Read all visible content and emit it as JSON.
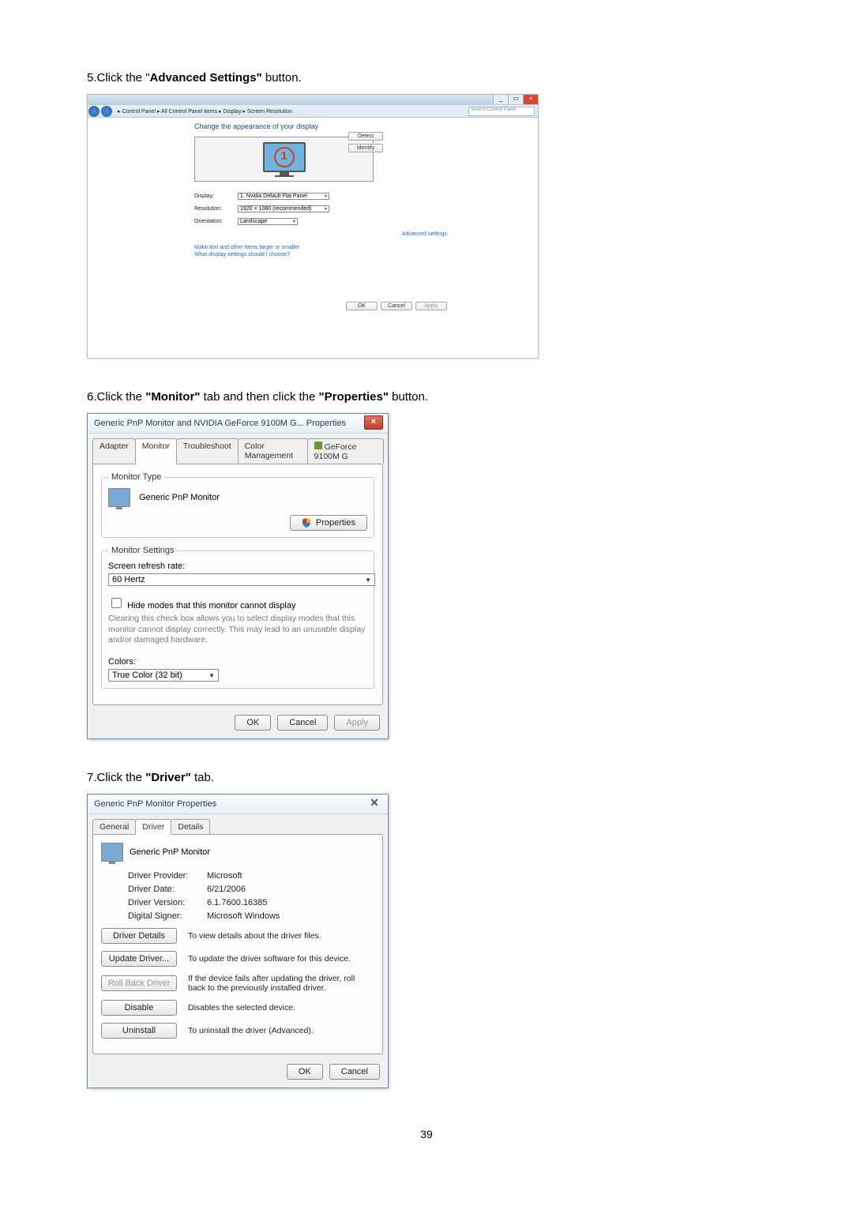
{
  "step5": {
    "text_prefix": "5.Click the \"",
    "text_bold": "Advanced Settings\"",
    "text_suffix": " button."
  },
  "shot1": {
    "breadcrumb": "▸ Control Panel ▸ All Control Panel Items ▸ Display ▸ Screen Resolution",
    "search_placeholder": "Search Control Panel",
    "heading": "Change the appearance of your display",
    "monitor_num": "1",
    "btn_detect": "Detect",
    "btn_identify": "Identify",
    "lbl_display": "Display:",
    "val_display": "1. Nvidia Default Flat Panel",
    "lbl_resolution": "Resolution:",
    "val_resolution": "1920 × 1080 (recommended)",
    "lbl_orientation": "Orientation:",
    "val_orientation": "Landscape",
    "adv_link": "Advanced settings",
    "link1": "Make text and other items larger or smaller",
    "link2": "What display settings should I choose?",
    "btn_ok": "OK",
    "btn_cancel": "Cancel",
    "btn_apply": "Apply"
  },
  "step6": {
    "text_prefix": "6.Click the ",
    "text_bold1": "\"Monitor\"",
    "text_mid": " tab and then click the ",
    "text_bold2": "\"Properties\"",
    "text_suffix": " button."
  },
  "dlg2": {
    "title": "Generic PnP Monitor and NVIDIA GeForce 9100M G... Properties",
    "tabs": {
      "adapter": "Adapter",
      "monitor": "Monitor",
      "troubleshoot": "Troubleshoot",
      "colormgmt": "Color Management",
      "gpu": "GeForce 9100M G"
    },
    "grp_monitor_type": "Monitor Type",
    "monitor_name": "Generic PnP Monitor",
    "btn_properties": "Properties",
    "grp_monitor_settings": "Monitor Settings",
    "lbl_refresh": "Screen refresh rate:",
    "val_refresh": "60 Hertz",
    "chk_hide": "Hide modes that this monitor cannot display",
    "helptext": "Clearing this check box allows you to select display modes that this monitor cannot display correctly. This may lead to an unusable display and/or damaged hardware.",
    "lbl_colors": "Colors:",
    "val_colors": "True Color (32 bit)",
    "btn_ok": "OK",
    "btn_cancel": "Cancel",
    "btn_apply": "Apply"
  },
  "step7": {
    "text_prefix": "7.Click the ",
    "text_bold": "\"Driver\"",
    "text_suffix": " tab."
  },
  "dlg3": {
    "title": "Generic PnP Monitor Properties",
    "tabs": {
      "general": "General",
      "driver": "Driver",
      "details": "Details"
    },
    "monitor_name": "Generic PnP Monitor",
    "lbl_provider": "Driver Provider:",
    "val_provider": "Microsoft",
    "lbl_date": "Driver Date:",
    "val_date": "6/21/2006",
    "lbl_version": "Driver Version:",
    "val_version": "6.1.7600.16385",
    "lbl_signer": "Digital Signer:",
    "val_signer": "Microsoft Windows",
    "btn_details": "Driver Details",
    "desc_details": "To view details about the driver files.",
    "btn_update": "Update Driver...",
    "desc_update": "To update the driver software for this device.",
    "btn_rollback": "Roll Back Driver",
    "desc_rollback": "If the device fails after updating the driver, roll back to the previously installed driver.",
    "btn_disable": "Disable",
    "desc_disable": "Disables the selected device.",
    "btn_uninstall": "Uninstall",
    "desc_uninstall": "To uninstall the driver (Advanced).",
    "btn_ok": "OK",
    "btn_cancel": "Cancel"
  },
  "page_number": "39"
}
